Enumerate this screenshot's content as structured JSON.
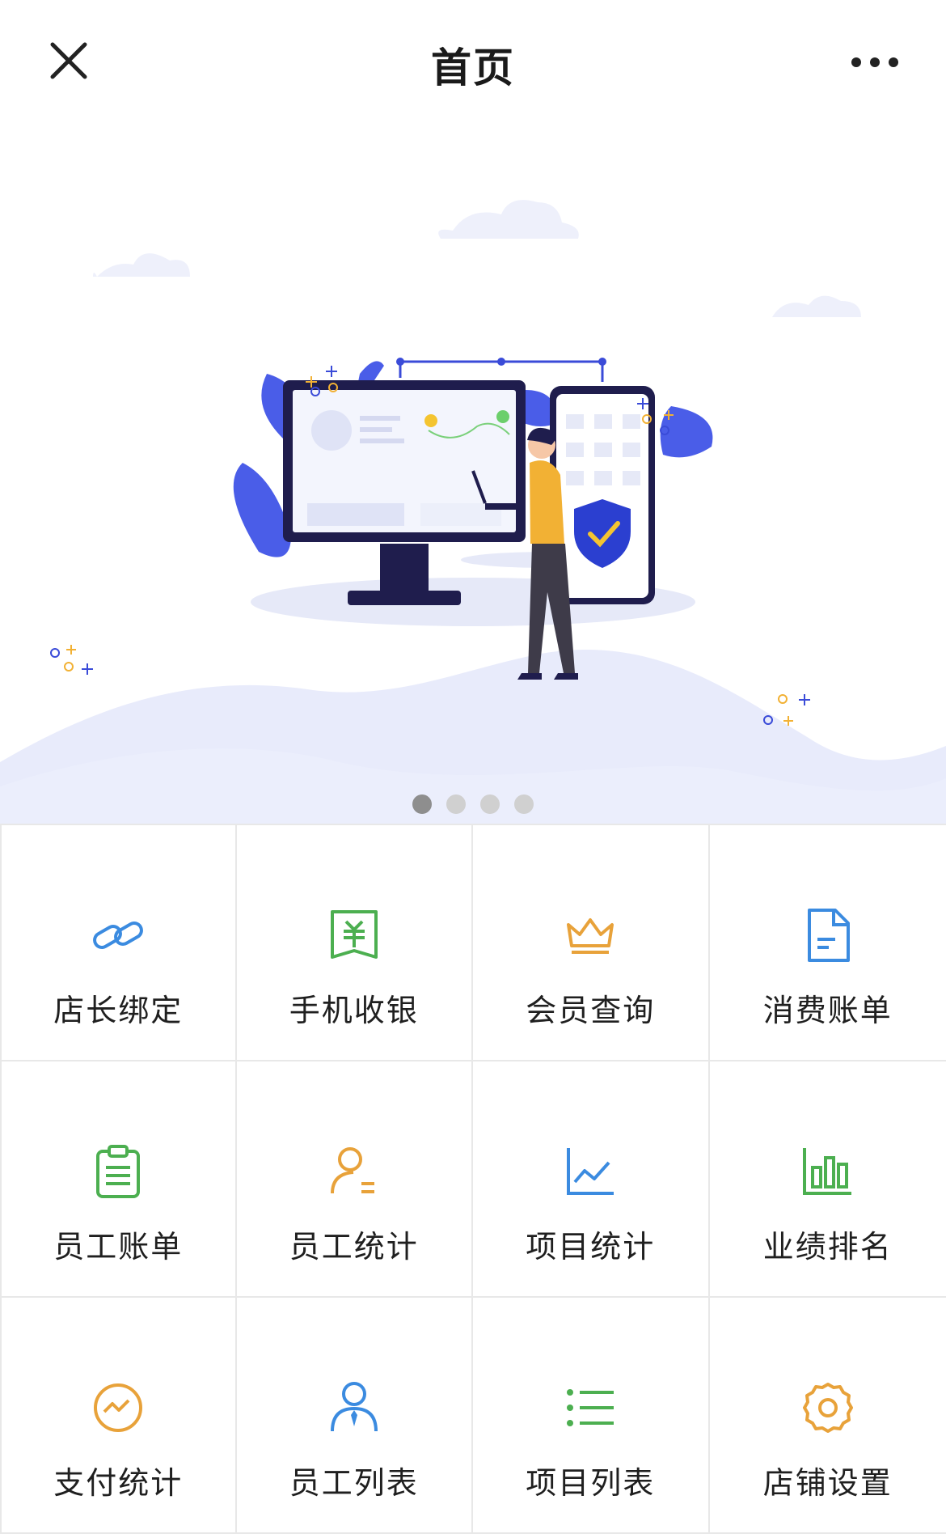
{
  "header": {
    "title": "首页"
  },
  "icons": {
    "close": "close-icon",
    "more": "more-icon"
  },
  "carousel": {
    "slide_count": 4,
    "active_index": 0
  },
  "menu": [
    {
      "label": "店长绑定",
      "icon": "link-icon",
      "color": "#3b8be0"
    },
    {
      "label": "手机收银",
      "icon": "cashier-icon",
      "color": "#4caf50"
    },
    {
      "label": "会员查询",
      "icon": "crown-icon",
      "color": "#e8a23a"
    },
    {
      "label": "消费账单",
      "icon": "document-icon",
      "color": "#3b8be0"
    },
    {
      "label": "员工账单",
      "icon": "clipboard-icon",
      "color": "#4caf50"
    },
    {
      "label": "员工统计",
      "icon": "user-stats-icon",
      "color": "#e8a23a"
    },
    {
      "label": "项目统计",
      "icon": "line-chart-icon",
      "color": "#3b8be0"
    },
    {
      "label": "业绩排名",
      "icon": "bar-chart-icon",
      "color": "#4caf50"
    },
    {
      "label": "支付统计",
      "icon": "payment-trend-icon",
      "color": "#e8a23a"
    },
    {
      "label": "员工列表",
      "icon": "staff-icon",
      "color": "#3b8be0"
    },
    {
      "label": "项目列表",
      "icon": "list-icon",
      "color": "#4caf50"
    },
    {
      "label": "店铺设置",
      "icon": "gear-icon",
      "color": "#e8a23a"
    }
  ]
}
